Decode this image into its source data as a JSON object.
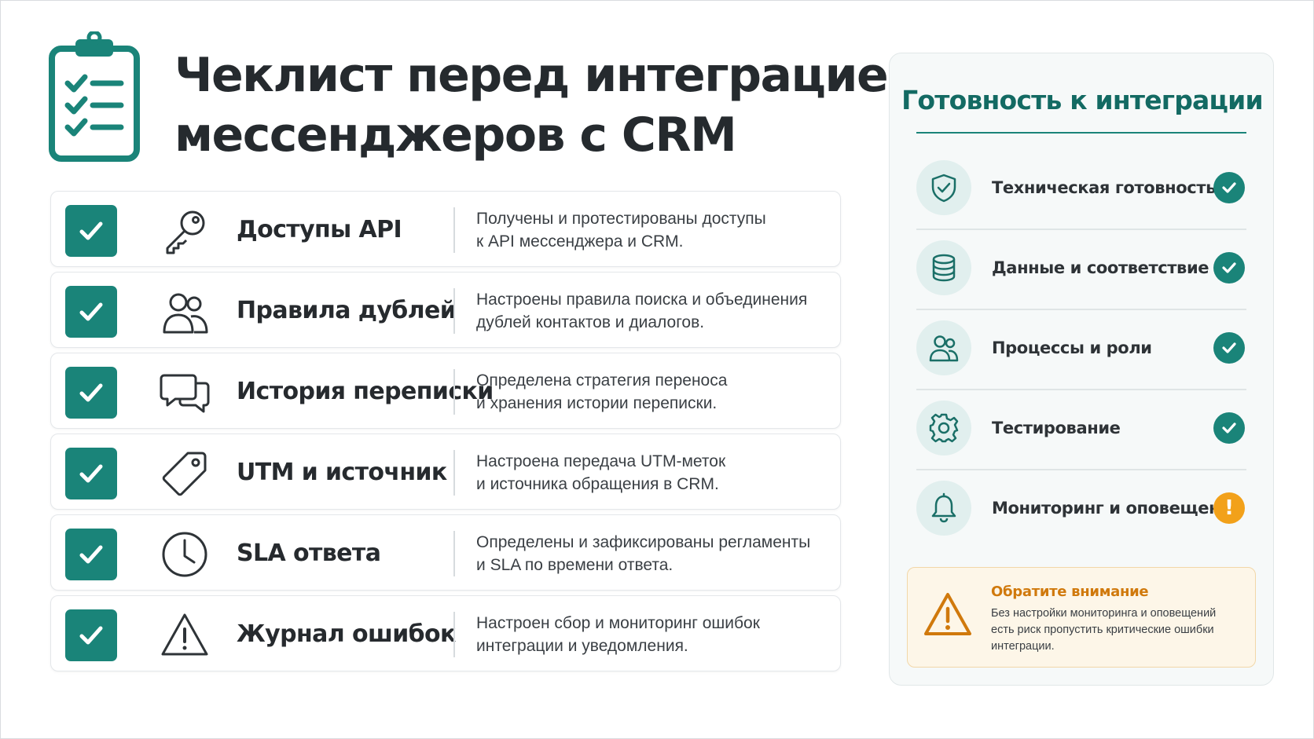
{
  "header": {
    "icon": "clipboard-checklist-icon",
    "title_line1": "Чеклист перед интеграцией",
    "title_line2": "мессенджеров с CRM"
  },
  "colors": {
    "accent": "#1a8479",
    "accent_dark": "#136a63",
    "warning": "#f2a11a",
    "warning_text": "#d0790c"
  },
  "checklist": [
    {
      "checked": true,
      "icon": "key-icon",
      "label": "Доступы API",
      "desc_line1": "Получены и протестированы доступы",
      "desc_line2": "к API мессенджера и CRM."
    },
    {
      "checked": true,
      "icon": "users-icon",
      "label": "Правила дублей",
      "desc_line1": "Настроены правила поиска и объединения",
      "desc_line2": "дублей контактов и диалогов."
    },
    {
      "checked": true,
      "icon": "chat-bubbles-icon",
      "label": "История переписки",
      "desc_line1": "Определена стратегия переноса",
      "desc_line2": "и хранения истории переписки."
    },
    {
      "checked": true,
      "icon": "tag-icon",
      "label": "UTM и источник",
      "desc_line1": "Настроена передача UTM-меток",
      "desc_line2": "и источника обращения в CRM."
    },
    {
      "checked": true,
      "icon": "clock-icon",
      "label": "SLA ответа",
      "desc_line1": "Определены и зафиксированы регламенты",
      "desc_line2": "и SLA по времени ответа."
    },
    {
      "checked": true,
      "icon": "warning-triangle-icon",
      "label": "Журнал ошибок",
      "desc_line1": "Настроен сбор и мониторинг ошибок",
      "desc_line2": "интеграции и уведомления."
    }
  ],
  "panel": {
    "title": "Готовность к интеграции",
    "items": [
      {
        "icon": "shield-check-icon",
        "label": "Техническая готовность",
        "status": "ok"
      },
      {
        "icon": "database-icon",
        "label": "Данные и соответствие",
        "status": "ok"
      },
      {
        "icon": "users-icon",
        "label": "Процессы и роли",
        "status": "ok"
      },
      {
        "icon": "gear-icon",
        "label": "Тестирование",
        "status": "ok"
      },
      {
        "icon": "bell-icon",
        "label": "Мониторинг и оповещения",
        "status": "warning",
        "status_glyph": "!"
      }
    ],
    "notice": {
      "icon": "warning-triangle-icon",
      "title": "Обратите внимание",
      "text_line1": "Без настройки мониторинга и оповещений",
      "text_line2": "есть риск пропустить критические ошибки",
      "text_line3": "интеграции."
    }
  }
}
